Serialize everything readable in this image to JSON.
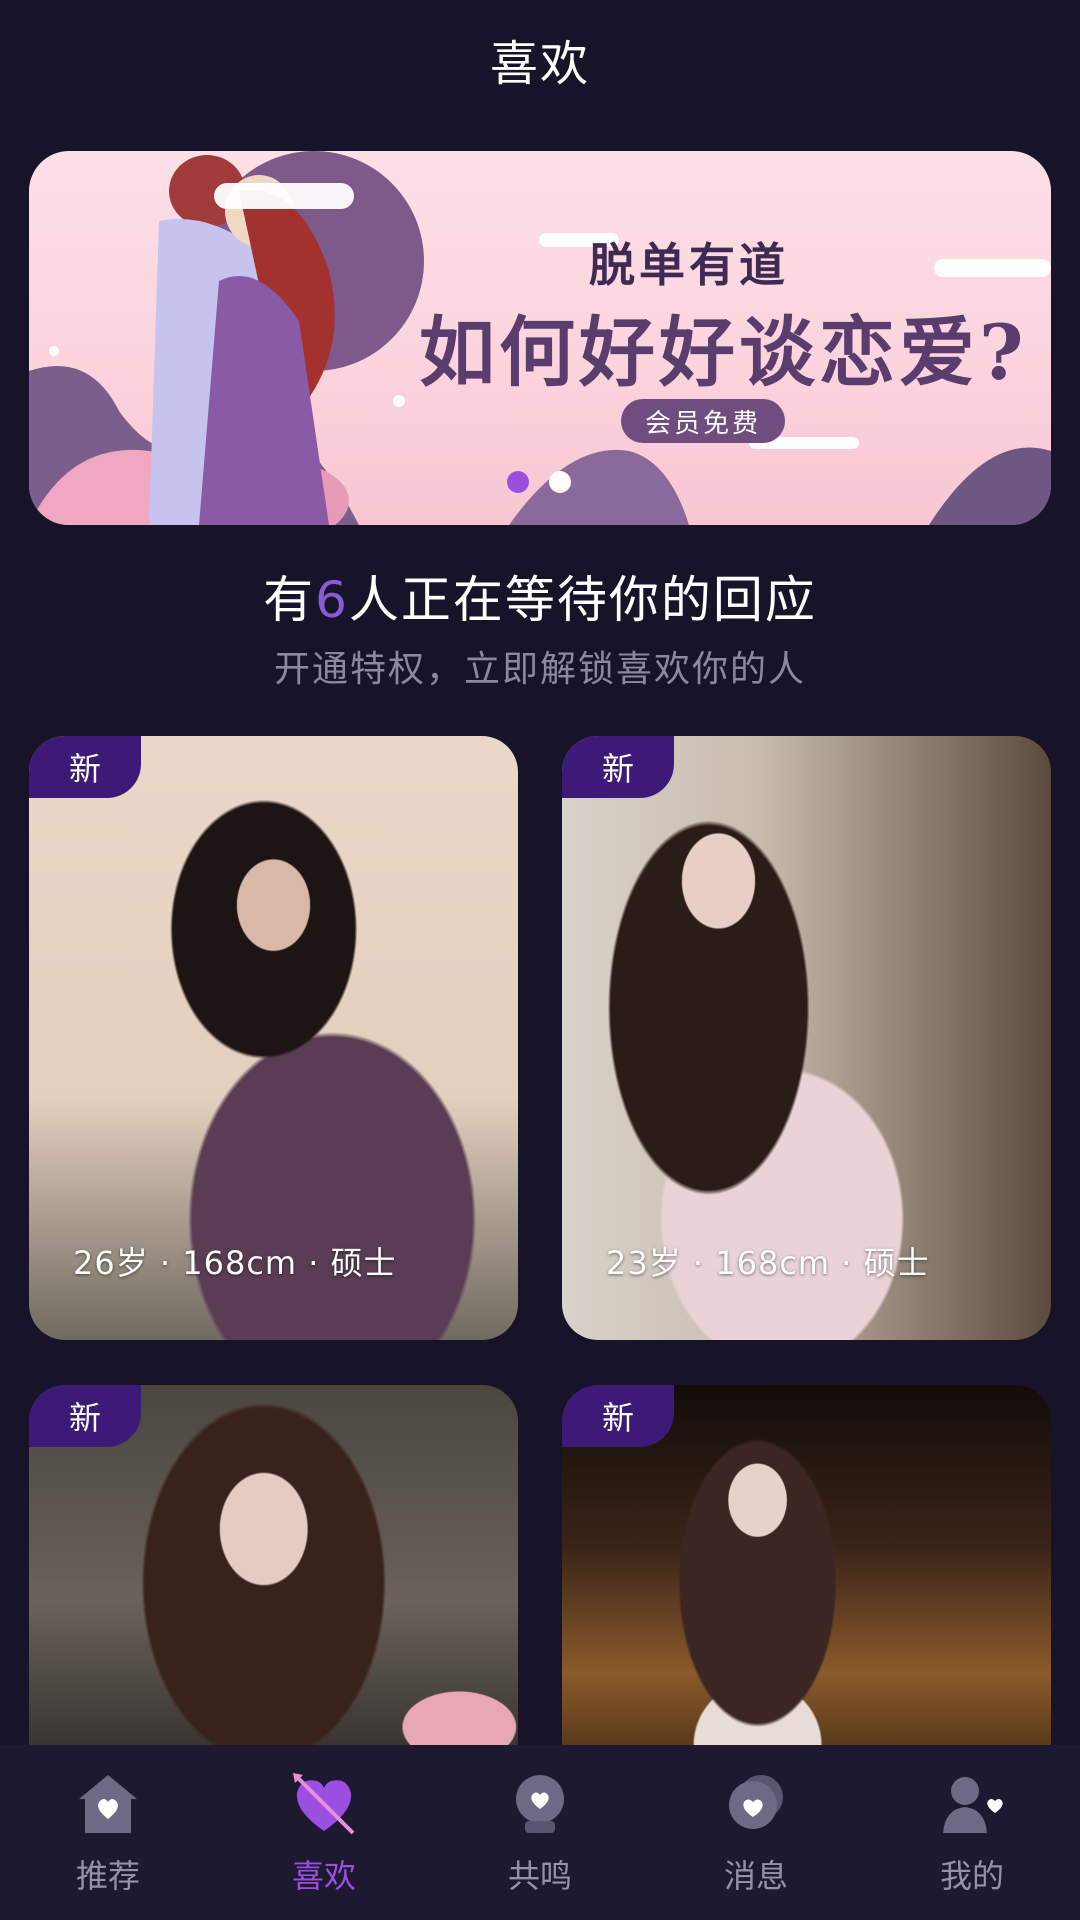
{
  "header": {
    "title": "喜欢"
  },
  "banner": {
    "title": "脱单有道",
    "headline": "如何好好谈恋爱?",
    "badge": "会员免费",
    "dots_total": 2,
    "dots_active_index": 0
  },
  "waiting": {
    "prefix": "有",
    "count": "6",
    "suffix": "人正在等待你的回应",
    "subtitle": "开通特权，立即解锁喜欢你的人"
  },
  "cards": [
    {
      "badge": "新",
      "info": "26岁 · 168cm · 硕士"
    },
    {
      "badge": "新",
      "info": "23岁 · 168cm · 硕士"
    },
    {
      "badge": "新"
    },
    {
      "badge": "新"
    }
  ],
  "tabbar": {
    "items": [
      {
        "label": "推荐",
        "icon": "house-heart-icon"
      },
      {
        "label": "喜欢",
        "icon": "heart-arrow-icon",
        "active": true
      },
      {
        "label": "共鸣",
        "icon": "crystal-ball-icon"
      },
      {
        "label": "消息",
        "icon": "chat-heart-icon"
      },
      {
        "label": "我的",
        "icon": "user-heart-icon"
      }
    ]
  },
  "colors": {
    "background": "#17142a",
    "accent": "#9a4fe0",
    "badge": "#3d1a78",
    "muted": "#9592a8"
  }
}
